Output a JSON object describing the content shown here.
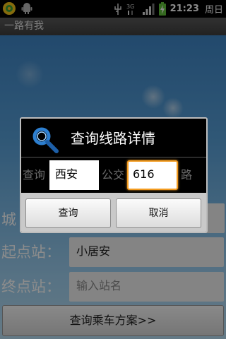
{
  "status_bar": {
    "time": "21:23",
    "day": "周日",
    "icons": [
      "app-notification-icon",
      "android-icon",
      "usb-icon",
      "signal-3g-icon",
      "signal-strength-icon",
      "battery-charging-icon"
    ]
  },
  "app": {
    "title": "一路有我"
  },
  "form": {
    "city_label": "城",
    "start_label": "起点站：",
    "start_value": "小居安",
    "end_label": "终点站：",
    "end_placeholder": "输入站名",
    "search_button": "查询乘车方案>>"
  },
  "dialog": {
    "icon": "search-icon",
    "title": "查询线路详情",
    "prefix_text": "查询",
    "city_value": "西安",
    "middle_text": "公交",
    "route_value": "616",
    "suffix_text": "路",
    "confirm_button": "查询",
    "cancel_button": "取消"
  },
  "colors": {
    "focus_border": "#f39b1f",
    "background_top": "#3f86c6",
    "background_bottom": "#b8def4"
  }
}
